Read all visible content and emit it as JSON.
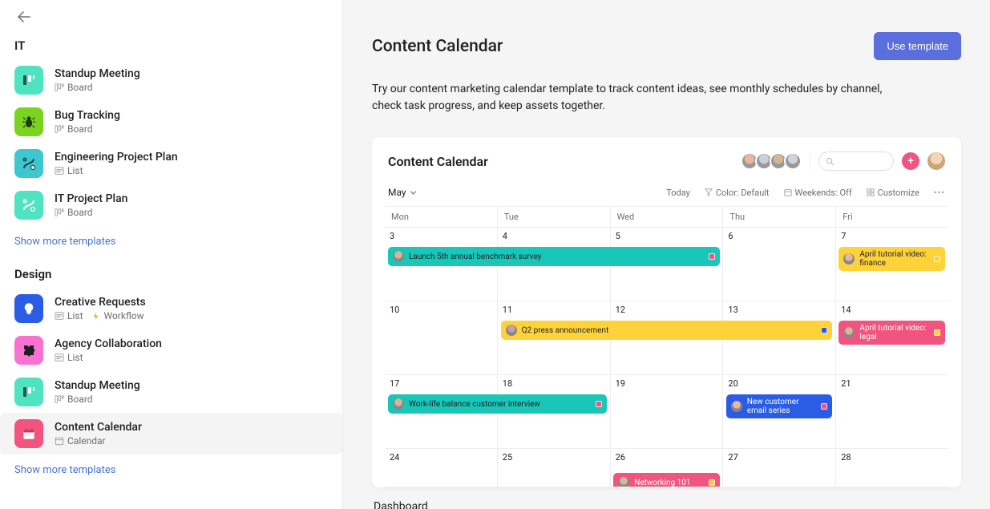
{
  "sidebar": {
    "sections": [
      {
        "title": "IT",
        "items": [
          {
            "name": "Standup Meeting",
            "sub": [
              {
                "icon": "board",
                "label": "Board"
              }
            ],
            "icon": {
              "bg": "#50E3C2",
              "type": "kanban"
            }
          },
          {
            "name": "Bug Tracking",
            "sub": [
              {
                "icon": "board",
                "label": "Board"
              }
            ],
            "icon": {
              "bg": "#7AD321",
              "type": "bug"
            }
          },
          {
            "name": "Engineering Project Plan",
            "sub": [
              {
                "icon": "list",
                "label": "List"
              }
            ],
            "icon": {
              "bg": "#3EC7CF",
              "type": "route-dark"
            }
          },
          {
            "name": "IT Project Plan",
            "sub": [
              {
                "icon": "board",
                "label": "Board"
              }
            ],
            "icon": {
              "bg": "#50E3C2",
              "type": "route-light"
            }
          }
        ],
        "show_more": "Show more templates"
      },
      {
        "title": "Design",
        "items": [
          {
            "name": "Creative Requests",
            "sub": [
              {
                "icon": "list",
                "label": "List"
              },
              {
                "icon": "bolt",
                "label": "Workflow"
              }
            ],
            "icon": {
              "bg": "#2B5CE6",
              "type": "bulb"
            }
          },
          {
            "name": "Agency Collaboration",
            "sub": [
              {
                "icon": "list",
                "label": "List"
              }
            ],
            "icon": {
              "bg": "#F772D1",
              "type": "puzzle"
            }
          },
          {
            "name": "Standup Meeting",
            "sub": [
              {
                "icon": "board",
                "label": "Board"
              }
            ],
            "icon": {
              "bg": "#50E3C2",
              "type": "kanban"
            }
          },
          {
            "name": "Content Calendar",
            "sub": [
              {
                "icon": "calendar",
                "label": "Calendar"
              }
            ],
            "icon": {
              "bg": "#F1547E",
              "type": "calendar"
            },
            "selected": true
          }
        ],
        "show_more": "Show more templates"
      }
    ]
  },
  "main": {
    "title": "Content Calendar",
    "use_button": "Use template",
    "description": "Try our content marketing calendar template to track content ideas, see monthly schedules by channel, check task progress, and keep assets together.",
    "section_label": "Dashboard"
  },
  "preview": {
    "title": "Content Calendar",
    "avatars": [
      "#e8b89b",
      "#c9d1d9",
      "#d4b896",
      "#cdd5dc"
    ],
    "toolbar": {
      "month": "May",
      "today": "Today",
      "color": "Color: Default",
      "weekends": "Weekends: Off",
      "customize": "Customize"
    },
    "days": [
      "Mon",
      "Tue",
      "Wed",
      "Thu",
      "Fri"
    ],
    "weeks": [
      {
        "dates": [
          "3",
          "4",
          "5",
          "6",
          "7"
        ],
        "events": [
          {
            "label": "Launch 5th annual benchmark survey",
            "bg": "#18C7B8",
            "fg": "#1e1f21",
            "start": 0,
            "end": 3,
            "badge": "#F1547E",
            "avatar": "#d4b896"
          },
          {
            "label": "April tutorial video: finance",
            "bg": "#FED33A",
            "fg": "#1e1f21",
            "start": 4,
            "end": 5,
            "badge": "#FED33A",
            "avatar": "#e8b89b",
            "multiline": true
          }
        ]
      },
      {
        "dates": [
          "10",
          "11",
          "12",
          "13",
          "14"
        ],
        "events": [
          {
            "label": "Q2 press announcement",
            "bg": "#FED33A",
            "fg": "#1e1f21",
            "start": 1,
            "end": 4,
            "badge": "#2B5CE6",
            "avatar": "#c9a0a0"
          },
          {
            "label": "April tutorial video: legal",
            "bg": "#F1547E",
            "fg": "#fff",
            "start": 4,
            "end": 5,
            "badge": "#FED33A",
            "avatar": "#d4b896",
            "multiline": true
          }
        ]
      },
      {
        "dates": [
          "17",
          "18",
          "19",
          "20",
          "21"
        ],
        "events": [
          {
            "label": "Work-life balance customer interview",
            "bg": "#18C7B8",
            "fg": "#1e1f21",
            "start": 0,
            "end": 2,
            "badge": "#F1547E",
            "avatar": "#d4b896"
          },
          {
            "label": "New customer email series",
            "bg": "#2B5CE6",
            "fg": "#fff",
            "start": 3,
            "end": 4,
            "badge": "#F1547E",
            "avatar": "#e8b89b",
            "multiline": true
          }
        ]
      },
      {
        "dates": [
          "24",
          "25",
          "26",
          "27",
          "28"
        ],
        "short": true,
        "events": [
          {
            "label": "Networking 101",
            "bg": "#F1547E",
            "fg": "#fff",
            "start": 2,
            "end": 3,
            "badge": "#FED33A",
            "avatar": "#d4b896",
            "offsetTop": 30
          }
        ]
      }
    ]
  }
}
